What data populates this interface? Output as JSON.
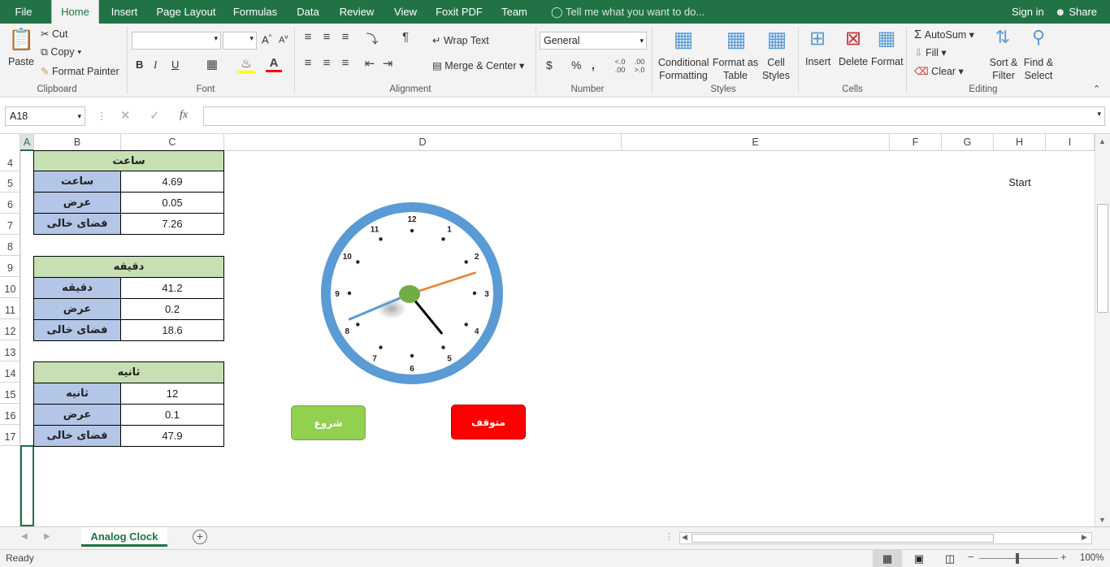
{
  "menu": {
    "file": "File",
    "home": "Home",
    "insert": "Insert",
    "page_layout": "Page Layout",
    "formulas": "Formulas",
    "data": "Data",
    "review": "Review",
    "view": "View",
    "foxit": "Foxit PDF",
    "team": "Team",
    "tell_me": "Tell me what you want to do...",
    "sign_in": "Sign in",
    "share": "Share"
  },
  "ribbon": {
    "paste": "Paste",
    "cut": "Cut",
    "copy": "Copy",
    "format_painter": "Format Painter",
    "clipboard": "Clipboard",
    "font": "Font",
    "bold": "B",
    "italic": "I",
    "underline": "U",
    "wrap_text": "Wrap Text",
    "merge_center": "Merge & Center",
    "alignment": "Alignment",
    "number_format": "General",
    "currency": "$",
    "percent": "%",
    "comma": ",",
    "number": "Number",
    "conditional_formatting": "Conditional Formatting",
    "format_as_table": "Format as Table",
    "cell_styles": "Cell Styles",
    "styles": "Styles",
    "insert": "Insert",
    "delete": "Delete",
    "format": "Format",
    "cells": "Cells",
    "autosum": "AutoSum",
    "fill": "Fill",
    "clear": "Clear",
    "sort_filter": "Sort & Filter",
    "find_select": "Find & Select",
    "editing": "Editing"
  },
  "formula_bar": {
    "name_box": "A18",
    "formula": ""
  },
  "columns": [
    "A",
    "B",
    "C",
    "D",
    "E",
    "F",
    "G",
    "H",
    "I"
  ],
  "rows": [
    "4",
    "5",
    "6",
    "7",
    "8",
    "9",
    "10",
    "11",
    "12",
    "13",
    "14",
    "15",
    "16",
    "17"
  ],
  "tables": {
    "hour": {
      "title": "ساعت",
      "r1_label": "ساعت",
      "r1_value": "4.69",
      "r2_label": "عرض",
      "r2_value": "0.05",
      "r3_label": "فضای خالی",
      "r3_value": "7.26"
    },
    "minute": {
      "title": "دقیقه",
      "r1_label": "دقیقه",
      "r1_value": "41.2",
      "r2_label": "عرض",
      "r2_value": "0.2",
      "r3_label": "فضای خالی",
      "r3_value": "18.6"
    },
    "second": {
      "title": "ثانیه",
      "r1_label": "ثانیه",
      "r1_value": "12",
      "r2_label": "عرض",
      "r2_value": "0.1",
      "r3_label": "فضای خالی",
      "r3_value": "47.9"
    }
  },
  "clock": {
    "numbers": [
      "12",
      "1",
      "2",
      "3",
      "4",
      "5",
      "6",
      "7",
      "8",
      "9",
      "10",
      "11"
    ],
    "hour_value": 4.69,
    "minute_value": 41.2,
    "second_value": 12,
    "rim_color": "#5b9bd5",
    "hub_color": "#70ad47",
    "hour_hand_color": "#000000",
    "minute_hand_color": "#5b9bd5",
    "second_hand_color": "#ed7d31"
  },
  "buttons": {
    "start": "شروع",
    "stop": "متوقف",
    "start_color": "#92d050",
    "stop_color": "#ff0000"
  },
  "cell_h5": "Start",
  "sheet_tab": "Analog Clock",
  "status": {
    "ready": "Ready",
    "zoom": "100%"
  }
}
